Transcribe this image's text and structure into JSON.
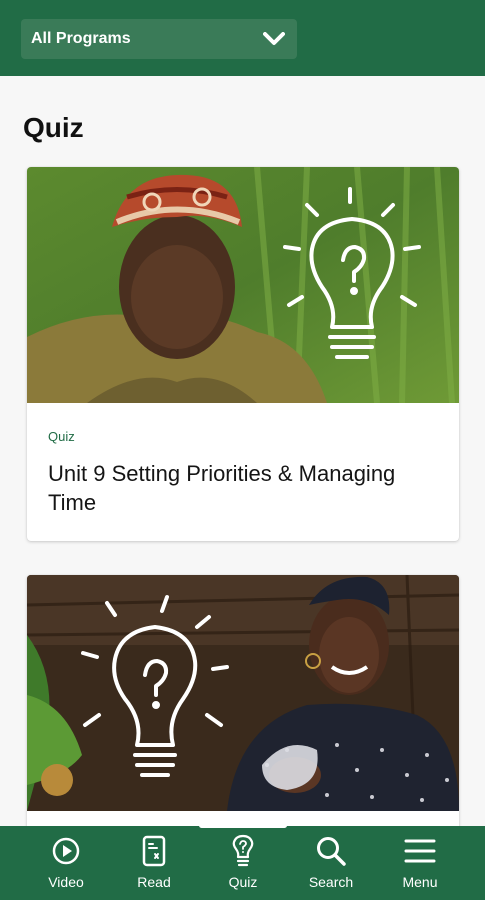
{
  "header": {
    "program_selector": {
      "value": "All Programs",
      "icon": "chevron-down-icon"
    }
  },
  "page": {
    "title": "Quiz"
  },
  "cards": [
    {
      "kicker": "Quiz",
      "title": "Unit 9 Setting Priorities & Managing Time",
      "image": "woman-in-headwrap-with-lightbulb-question-icon"
    },
    {
      "kicker": "",
      "title": "",
      "image": "smiling-woman-with-lightbulb-question-icon"
    }
  ],
  "bottom_nav": {
    "items": [
      {
        "label": "Video",
        "icon": "play-circle-icon"
      },
      {
        "label": "Read",
        "icon": "document-icon"
      },
      {
        "label": "Quiz",
        "icon": "lightbulb-icon"
      },
      {
        "label": "Search",
        "icon": "search-icon"
      },
      {
        "label": "Menu",
        "icon": "menu-icon"
      }
    ]
  },
  "colors": {
    "brand_green": "#216c46",
    "select_bg": "#3a7b58",
    "background": "#f7f7f7"
  }
}
